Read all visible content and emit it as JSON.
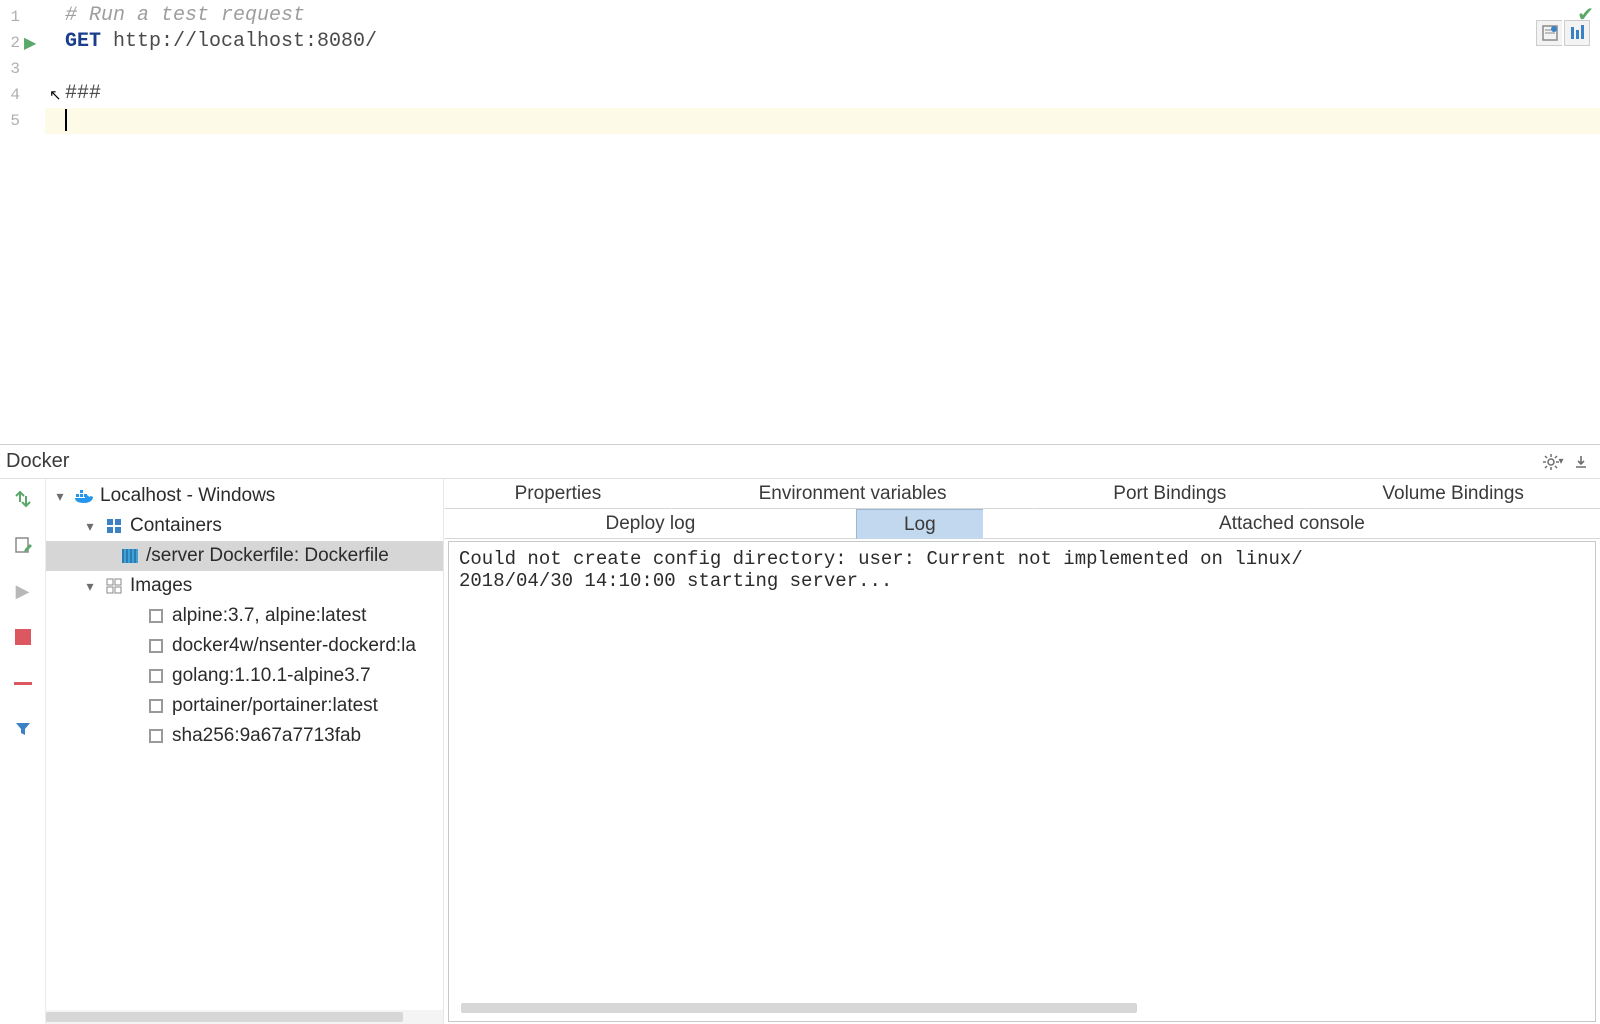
{
  "editor": {
    "lines": [
      "1",
      "2",
      "3",
      "4",
      "5"
    ],
    "comment": "# Run a test request",
    "method": "GET",
    "url": " http://localhost:8080/",
    "separator": "###"
  },
  "panel": {
    "title": "Docker"
  },
  "tree": {
    "root": "Localhost - Windows",
    "containers_label": "Containers",
    "container_item": "/server Dockerfile: Dockerfile",
    "images_label": "Images",
    "images": [
      "alpine:3.7, alpine:latest",
      "docker4w/nsenter-dockerd:la",
      "golang:1.10.1-alpine3.7",
      "portainer/portainer:latest",
      "sha256:9a67a7713fab"
    ]
  },
  "tabs_row1": {
    "properties": "Properties",
    "env": "Environment variables",
    "port": "Port Bindings",
    "vol": "Volume Bindings"
  },
  "tabs_row2": {
    "deploy": "Deploy log",
    "log": "Log",
    "console": "Attached console"
  },
  "log": {
    "line1": "Could not create config directory: user: Current not implemented on linux/",
    "line2": "2018/04/30 14:10:00 starting server..."
  }
}
